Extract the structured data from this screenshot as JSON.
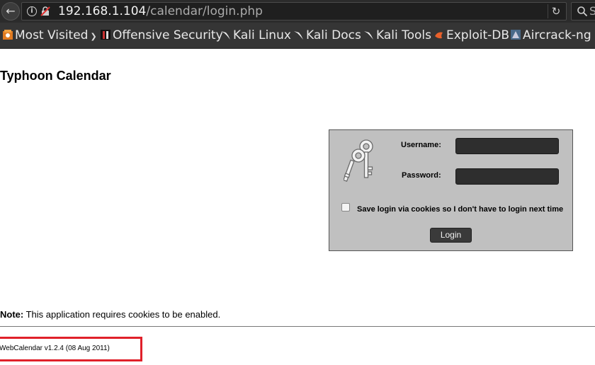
{
  "browser": {
    "url_host": "192.168.1.104",
    "url_path": "/calendar/login.php",
    "search_placeholder": "S"
  },
  "bookmarks": [
    {
      "label": "Most Visited",
      "icon": "most-visited-icon"
    },
    {
      "label": "Offensive Security",
      "icon": "offsec-icon"
    },
    {
      "label": "Kali Linux",
      "icon": "kali-dragon-icon"
    },
    {
      "label": "Kali Docs",
      "icon": "kali-dragon-icon"
    },
    {
      "label": "Kali Tools",
      "icon": "kali-dragon-icon"
    },
    {
      "label": "Exploit-DB",
      "icon": "exploit-db-icon"
    },
    {
      "label": "Aircrack-ng",
      "icon": "aircrack-icon"
    }
  ],
  "page": {
    "title": "Typhoon Calendar",
    "note_prefix": "Note:",
    "note_text": " This application requires cookies to be enabled.",
    "version": "WebCalendar v1.2.4 (08 Aug 2011)"
  },
  "login": {
    "username_label": "Username:",
    "password_label": "Password:",
    "username_value": "",
    "password_value": "",
    "remember_label": "Save login via cookies so I don't have to login next time",
    "remember_checked": false,
    "button_label": "Login"
  },
  "colors": {
    "chrome_bg": "#2b2b2b",
    "bookmark_bar_bg": "#353535",
    "login_panel_bg": "#c0c0c0",
    "highlight_border": "#e0202a"
  }
}
